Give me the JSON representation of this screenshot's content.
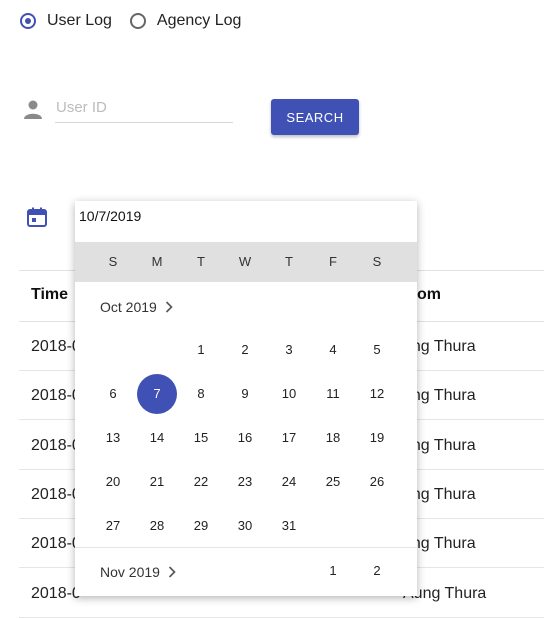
{
  "radios": {
    "user_log": "User Log",
    "agency_log": "Agency Log",
    "selected": "user_log"
  },
  "user_id": {
    "placeholder": "User ID",
    "value": ""
  },
  "search_button": "SEARCH",
  "date_field": {
    "value": "10/7/2019"
  },
  "icons": {
    "person": "person-icon",
    "calendar": "calendar-icon",
    "chevron": "chevron-right-icon"
  },
  "colors": {
    "accent": "#3f51b5",
    "weekday_bar": "#e0e0e0"
  },
  "table": {
    "headers": [
      "Time",
      "om"
    ],
    "rows": [
      {
        "time": "2018-0",
        "from": "ung Thura"
      },
      {
        "time": "2018-0",
        "from": "ung Thura"
      },
      {
        "time": "2018-0",
        "from": "ung Thura"
      },
      {
        "time": "2018-0",
        "from": "ung Thura"
      },
      {
        "time": "2018-0",
        "from": "ung Thura"
      },
      {
        "time": "2018-0",
        "from": "Aung Thura"
      }
    ]
  },
  "calendar": {
    "weekdays": [
      "S",
      "M",
      "T",
      "W",
      "T",
      "F",
      "S"
    ],
    "month": "Oct 2019",
    "selected_day": "7",
    "weeks": [
      [
        "",
        "",
        "1",
        "2",
        "3",
        "4",
        "5"
      ],
      [
        "6",
        "7",
        "8",
        "9",
        "10",
        "11",
        "12"
      ],
      [
        "13",
        "14",
        "15",
        "16",
        "17",
        "18",
        "19"
      ],
      [
        "20",
        "21",
        "22",
        "23",
        "24",
        "25",
        "26"
      ],
      [
        "27",
        "28",
        "29",
        "30",
        "31",
        "",
        ""
      ]
    ],
    "next_month": "Nov 2019",
    "next_month_days": [
      "",
      "",
      "",
      "",
      "",
      "1",
      "2"
    ]
  }
}
